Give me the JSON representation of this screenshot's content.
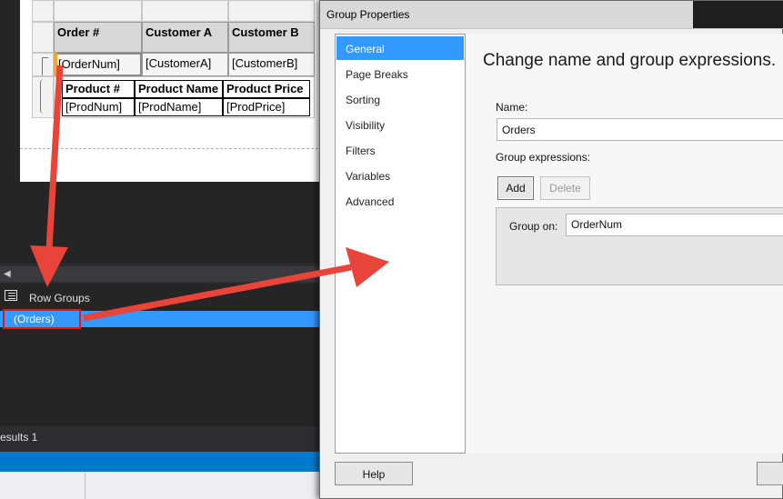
{
  "report": {
    "headers": [
      "Order #",
      "Customer A",
      "Customer B"
    ],
    "values": [
      "[OrderNum]",
      "[CustomerA]",
      "[CustomerB]"
    ],
    "sub_headers": [
      "Product #",
      "Product Name",
      "Product Price"
    ],
    "sub_values": [
      "[ProdNum]",
      "[ProdName]",
      "[ProdPrice]"
    ]
  },
  "row_groups": {
    "title": "Row Groups",
    "selected_item": "(Orders)"
  },
  "results_tab": "esults 1",
  "dialog": {
    "title": "Group Properties",
    "nav_items": [
      "General",
      "Page Breaks",
      "Sorting",
      "Visibility",
      "Filters",
      "Variables",
      "Advanced"
    ],
    "selected_nav": "General",
    "heading": "Change name and group expressions.",
    "name_label": "Name:",
    "name_value": "Orders",
    "group_expressions_label": "Group expressions:",
    "add_label": "Add",
    "delete_label": "Delete",
    "group_on_label": "Group on:",
    "group_on_value": "OrderNum",
    "help_label": "Help"
  },
  "colors": {
    "selection": "#3399ff",
    "annotation_red": "#e8443a",
    "statusbar": "#007acc"
  }
}
